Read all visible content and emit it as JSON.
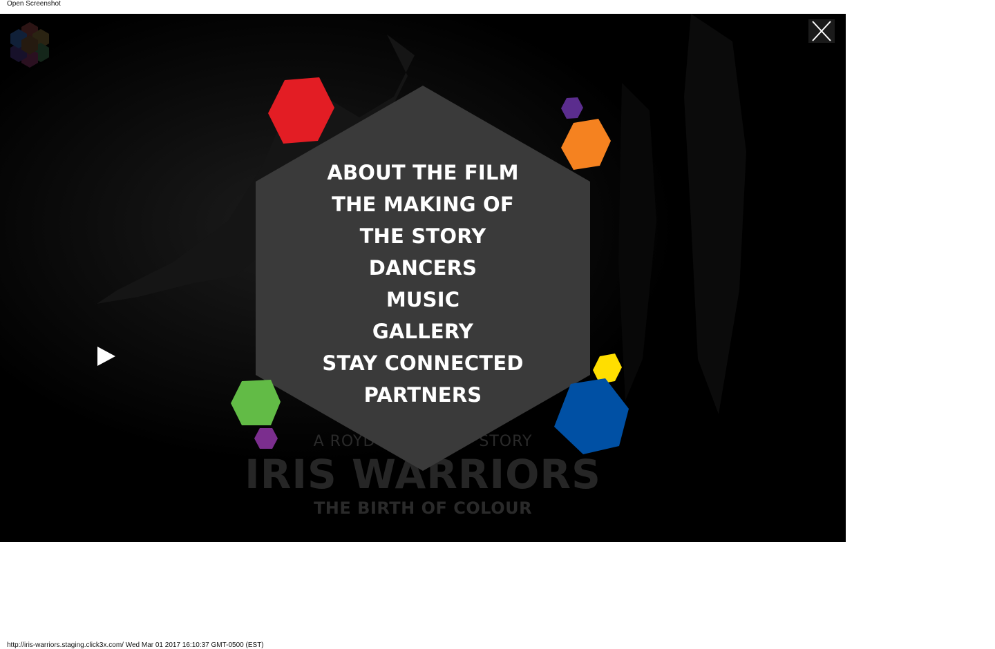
{
  "screenshot_caption": "Open Screenshot",
  "page_footer": "http://iris-warriors.staging.click3x.com/ Wed Mar 01 2017 16:10:37 GMT-0500 (EST)",
  "logo": {
    "icon": "hexagon-cluster-logo-icon"
  },
  "close_button": {
    "icon": "close-icon"
  },
  "play_button": {
    "icon": "play-icon"
  },
  "menu": {
    "items": [
      {
        "label": "ABOUT THE FILM"
      },
      {
        "label": "THE MAKING OF"
      },
      {
        "label": "THE STORY"
      },
      {
        "label": "DANCERS"
      },
      {
        "label": "MUSIC"
      },
      {
        "label": "GALLERY"
      },
      {
        "label": "STAY CONNECTED"
      },
      {
        "label": "PARTNERS"
      }
    ],
    "panel_color": "#3a3a3a",
    "text_color": "#ffffff"
  },
  "film_title": {
    "subtitle_left": "A ROYD",
    "subtitle_right": "STORY",
    "title": "IRIS WARRIORS",
    "tagline": "THE BIRTH OF COLOUR"
  },
  "decorations": {
    "colors": {
      "red": "#e31d24",
      "orange": "#f58220",
      "purple_small_top": "#5b2d8e",
      "green": "#62bb46",
      "purple_small_bottom": "#7b2e8e",
      "yellow": "#ffde00",
      "blue": "#0050a4"
    }
  }
}
